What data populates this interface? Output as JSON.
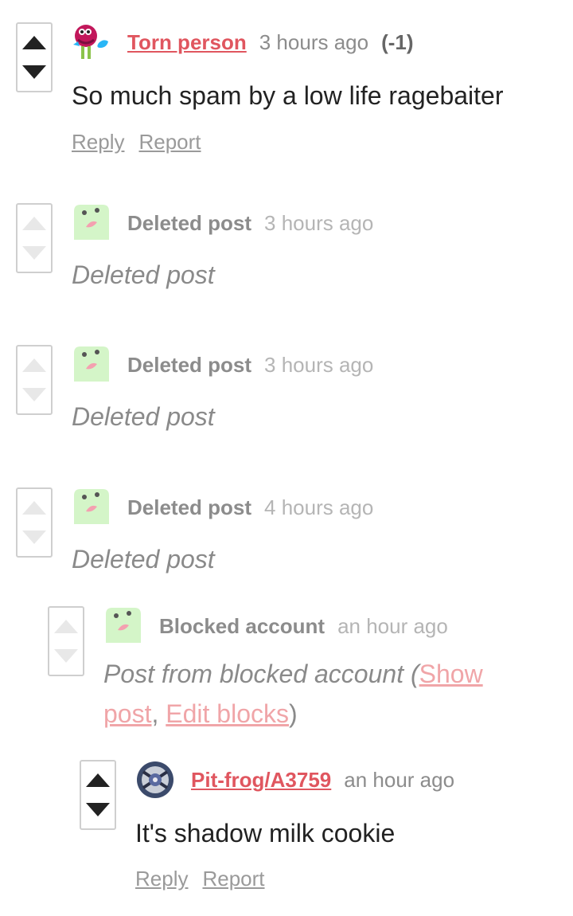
{
  "comments": [
    {
      "author": "Torn person",
      "time": "3 hours ago",
      "score": "(-1)",
      "body": "So much spam by a low life ragebaiter",
      "reply": "Reply",
      "report": "Report"
    },
    {
      "author": "Deleted post",
      "time": "3 hours ago",
      "body": "Deleted post"
    },
    {
      "author": "Deleted post",
      "time": "3 hours ago",
      "body": "Deleted post"
    },
    {
      "author": "Deleted post",
      "time": "4 hours ago",
      "body": "Deleted post"
    },
    {
      "author": "Blocked account",
      "time": "an hour ago",
      "body_prefix": "Post from blocked account (",
      "show_post": "Show post",
      "separator": ",",
      "edit_blocks": "Edit blocks",
      "body_suffix": ")"
    },
    {
      "author": "Pit-frog/A3759",
      "time": "an hour ago",
      "body": "It's shadow milk cookie",
      "reply": "Reply",
      "report": "Report"
    }
  ],
  "colors": {
    "link": "#e0565f",
    "muted": "#8c8c8c",
    "blocked_link": "#f0a5a8",
    "vote_border": "#cfcfcf"
  }
}
